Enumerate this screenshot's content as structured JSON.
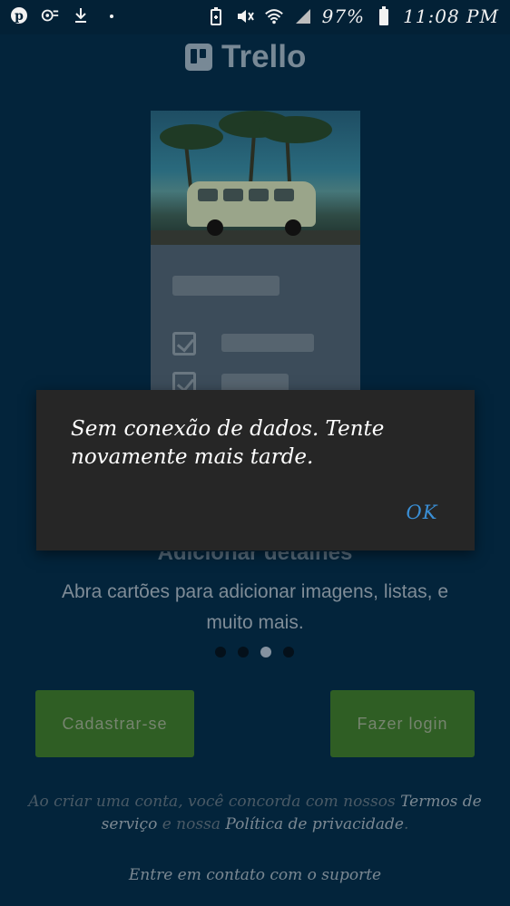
{
  "status_bar": {
    "battery_percent": "97%",
    "time": "11:08 PM",
    "left_icons": [
      "pinterest-icon",
      "settings-sync-icon",
      "download-icon",
      "dot-icon"
    ],
    "right_icons": [
      "battery-saver-icon",
      "mute-icon",
      "wifi-icon",
      "signal-icon",
      "battery-icon"
    ]
  },
  "header": {
    "app_name": "Trello"
  },
  "dialog": {
    "message": "Sem conexão de dados. Tente novamente mais tarde.",
    "ok_label": "OK"
  },
  "slide": {
    "title": "Adicionar detalhes",
    "description": "Abra cartões para adicionar imagens, listas, e muito mais.",
    "page_count": 4,
    "active_page": 3
  },
  "actions": {
    "signup_label": "Cadastrar-se",
    "login_label": "Fazer login"
  },
  "legal": {
    "prefix": "Ao criar uma conta, você concorda com nossos ",
    "terms_link": "Termos de serviço",
    "middle": " e nossa ",
    "privacy_link": "Política de privacidade",
    "suffix": "."
  },
  "support": {
    "label": "Entre em contato com o suporte"
  },
  "colors": {
    "background": "#03243b",
    "dialog_bg": "#262626",
    "ok_accent": "#3a8fd6",
    "button_green": "#2f5e24"
  }
}
